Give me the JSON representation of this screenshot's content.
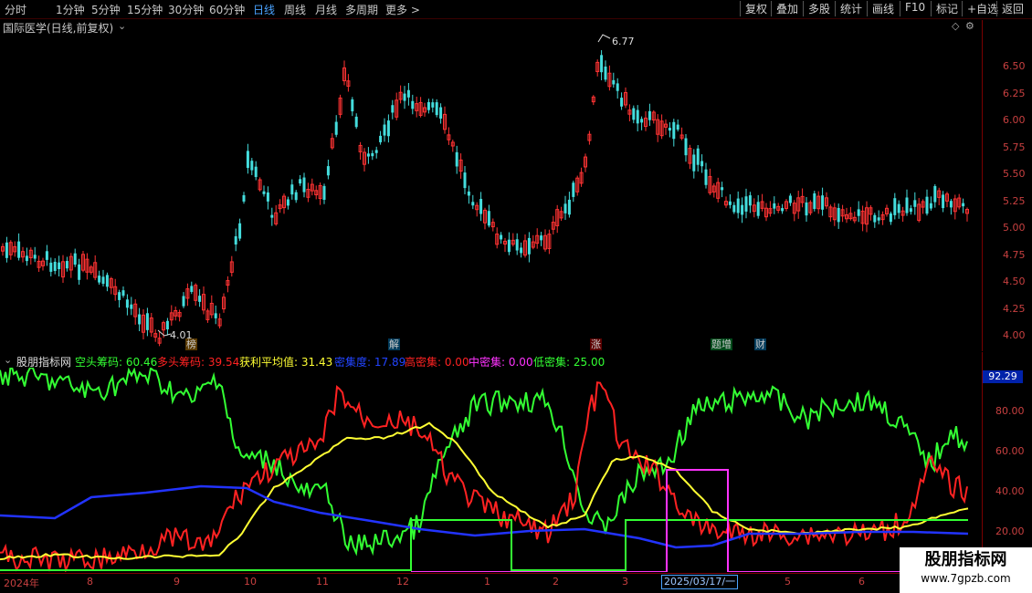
{
  "toolbar": {
    "timeframes": [
      "分时",
      "1分钟",
      "5分钟",
      "15分钟",
      "30分钟",
      "60分钟",
      "日线",
      "周线",
      "月线",
      "多周期",
      "更多 >"
    ],
    "active_timeframe": "日线",
    "buttons": [
      "复权",
      "叠加",
      "多股",
      "统计",
      "画线",
      "F10",
      "标记",
      "+自选",
      "返回"
    ]
  },
  "stock_title": "国际医学(日线,前复权)",
  "price_axis": [
    "6.50",
    "6.25",
    "6.00",
    "5.75",
    "5.50",
    "5.25",
    "5.00",
    "4.75",
    "4.50",
    "4.25",
    "4.00"
  ],
  "price_high_label": "6.77",
  "price_low_label": "4.01",
  "events": [
    {
      "label": "榜",
      "color": "#ff9a2a"
    },
    {
      "label": "解",
      "color": "#33bbff"
    },
    {
      "label": "涨",
      "color": "#ff3333"
    },
    {
      "label": "题增",
      "color": "#33ff66"
    },
    {
      "label": "财",
      "color": "#33bbff"
    }
  ],
  "indicator": {
    "name": "股朋指标网",
    "items": [
      {
        "label": "空头筹码: 60.46",
        "color": "#33ff33"
      },
      {
        "label": "多头筹码: 39.54",
        "color": "#ff2222"
      },
      {
        "label": "获利平均值: 31.43",
        "color": "#ffff33"
      },
      {
        "label": "密集度: 17.89",
        "color": "#2233ff"
      },
      {
        "label": "高密集: 0.00",
        "color": "#ff2222"
      },
      {
        "label": "中密集: 0.00",
        "color": "#ff33ff"
      },
      {
        "label": "低密集: 25.00",
        "color": "#33ff33"
      }
    ],
    "axis": [
      "80.00",
      "60.00",
      "40.00",
      "20.00"
    ],
    "current_value": "92.29"
  },
  "dates": [
    "2024年",
    "8",
    "9",
    "10",
    "11",
    "12",
    "1",
    "2",
    "3",
    "4",
    "5",
    "6"
  ],
  "cursor_date": "2025/03/17/一",
  "watermark": {
    "title": "股朋指标网",
    "url": "www.7gpzb.com"
  },
  "colors": {
    "up": "#ff3333",
    "down": "#44dddd",
    "axis": "#c84040"
  }
}
